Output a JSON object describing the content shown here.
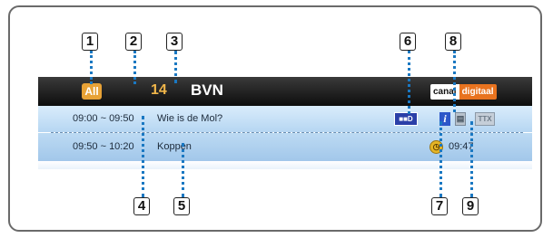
{
  "callouts": [
    "1",
    "2",
    "3",
    "4",
    "5",
    "6",
    "7",
    "8",
    "9"
  ],
  "info_banner": {
    "genre_filter": "All",
    "channel_number": "14",
    "channel_name": "BVN",
    "provider_logo": {
      "part1": "canal",
      "part2": "digitaal"
    },
    "current_program": {
      "time": "09:00 ~ 09:50",
      "title": "Wie is de Mol?"
    },
    "next_program": {
      "time": "09:50 ~ 10:20",
      "title": "Koppen"
    },
    "clock": "09:47",
    "icons": {
      "dolby": "dolby-digital-icon",
      "info": "info-icon",
      "subtitle": "subtitle-icon",
      "teletext": "teletext-icon",
      "reminder": "reminder-clock-icon"
    }
  },
  "colors": {
    "frame_border": "#6a6a6a",
    "dotted_leader": "#1a78c2",
    "topbar": "#0d0d0d",
    "row_bg": "#c4e0f7",
    "genre_pill": "#e8a236",
    "channel_number": "#f0b64a",
    "logo_accent": "#e8731f"
  }
}
